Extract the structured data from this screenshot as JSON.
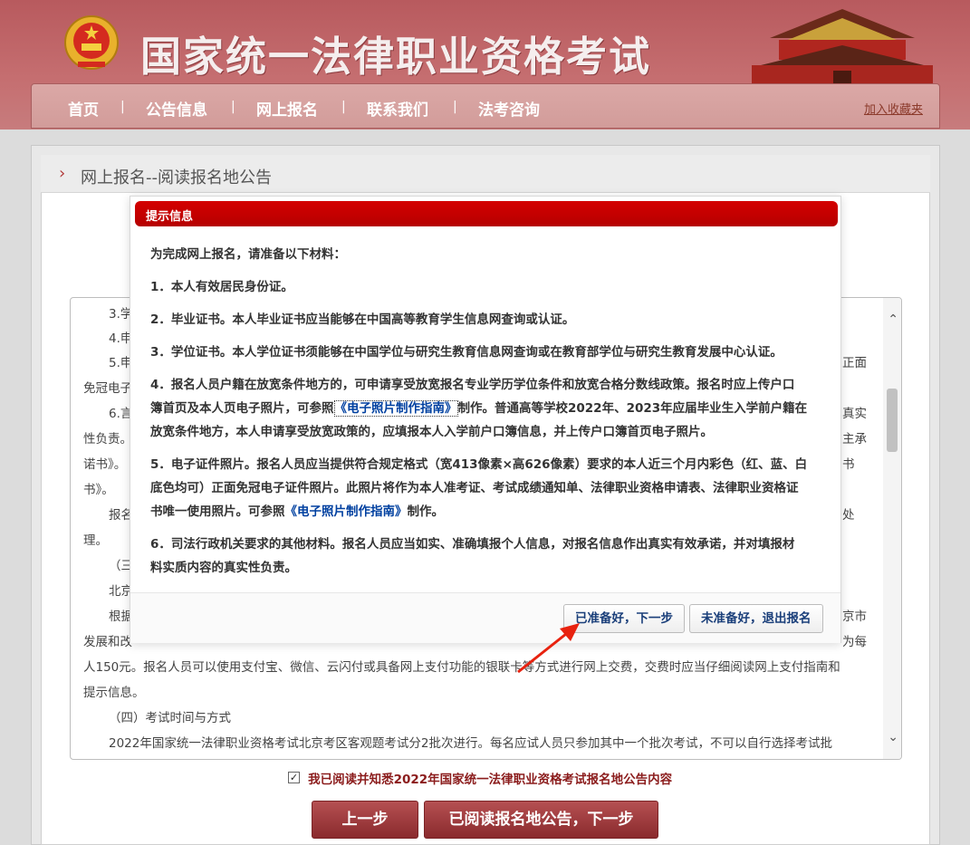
{
  "site": {
    "title": "国家统一法律职业资格考试",
    "nav": [
      "首页",
      "公告信息",
      "网上报名",
      "联系我们",
      "法考咨询"
    ],
    "nav_separator": "|",
    "favorite_link": "加入收藏夹"
  },
  "panel": {
    "title": "网上报名--阅读报名地公告"
  },
  "notice_lines": [
    "3.学",
    "4.申",
    "5.申",
    "免冠电子",
    "6.言",
    "性负责。",
    "诺书》。",
    "书》。",
    "报名",
    "理。",
    "（三",
    "北京",
    "根据",
    "发展和改",
    "人150元。报名人员可以使用支付宝、微信、云闪付或具备网上支付功能的银联卡等方式进行网上交费，交费时应当仔细阅读网上支付指南和",
    "提示信息。",
    "（四）考试时间与方式",
    "2022年国家统一法律职业资格考试北京考区客观题考试分2批次进行。每名应试人员只参加其中一个批次考试，不可以自行选择考试批"
  ],
  "notice_right_fragments": [
    "正面",
    "真实",
    "主承",
    "书",
    "处",
    "京市",
    "为每"
  ],
  "agree": {
    "checked": true,
    "text": "我已阅读并知悉2022年国家统一法律职业资格考试报名地公告内容"
  },
  "buttons": {
    "prev": "上一步",
    "next": "已阅读报名地公告，下一步"
  },
  "modal": {
    "title": "提示信息",
    "intro": "为完成网上报名，请准备以下材料：",
    "item1": "1．本人有效居民身份证。",
    "item2": "2．毕业证书。本人毕业证书应当能够在中国高等教育学生信息网查询或认证。",
    "item3": "3．学位证书。本人学位证书须能够在中国学位与研究生教育信息网查询或在教育部学位与研究生教育发展中心认证。",
    "item4_l1": "4．报名人员户籍在放宽条件地方的，可申请享受放宽报名专业学历学位条件和放宽合格分数线政策。报名时应上传户口",
    "item4_l2a": "簿首页及本人页电子照片，可参照",
    "item4_l2_link": "《电子照片制作指南》",
    "item4_l2b": "制作。普通高等学校2022年、2023年应届毕业生入学前户籍在",
    "item4_l3": "放宽条件地方，本人申请享受放宽政策的，应填报本人入学前户口簿信息，并上传户口簿首页电子照片。",
    "item5_l1": "5．电子证件照片。报名人员应当提供符合规定格式（宽413像素×高626像素）要求的本人近三个月内彩色（红、蓝、白",
    "item5_l2": "底色均可）正面免冠电子证件照片。此照片将作为本人准考证、考试成绩通知单、法律职业资格申请表、法律职业资格证",
    "item5_l3a": "书唯一使用照片。可参照",
    "item5_l3_link": "《电子照片制作指南》",
    "item5_l3b": "制作。",
    "item6_l1": "6．司法行政机关要求的其他材料。报名人员应当如实、准确填报个人信息，对报名信息作出真实有效承诺，并对填报材",
    "item6_l2": "料实质内容的真实性负责。",
    "btn_ready": "已准备好，下一步",
    "btn_not_ready": "未准备好，退出报名"
  },
  "colors": {
    "banner": "#c06466",
    "modal_header": "#cc0000",
    "button": "#9e3a3d",
    "link": "#0040a0",
    "annotation_arrow": "#e8220f"
  }
}
